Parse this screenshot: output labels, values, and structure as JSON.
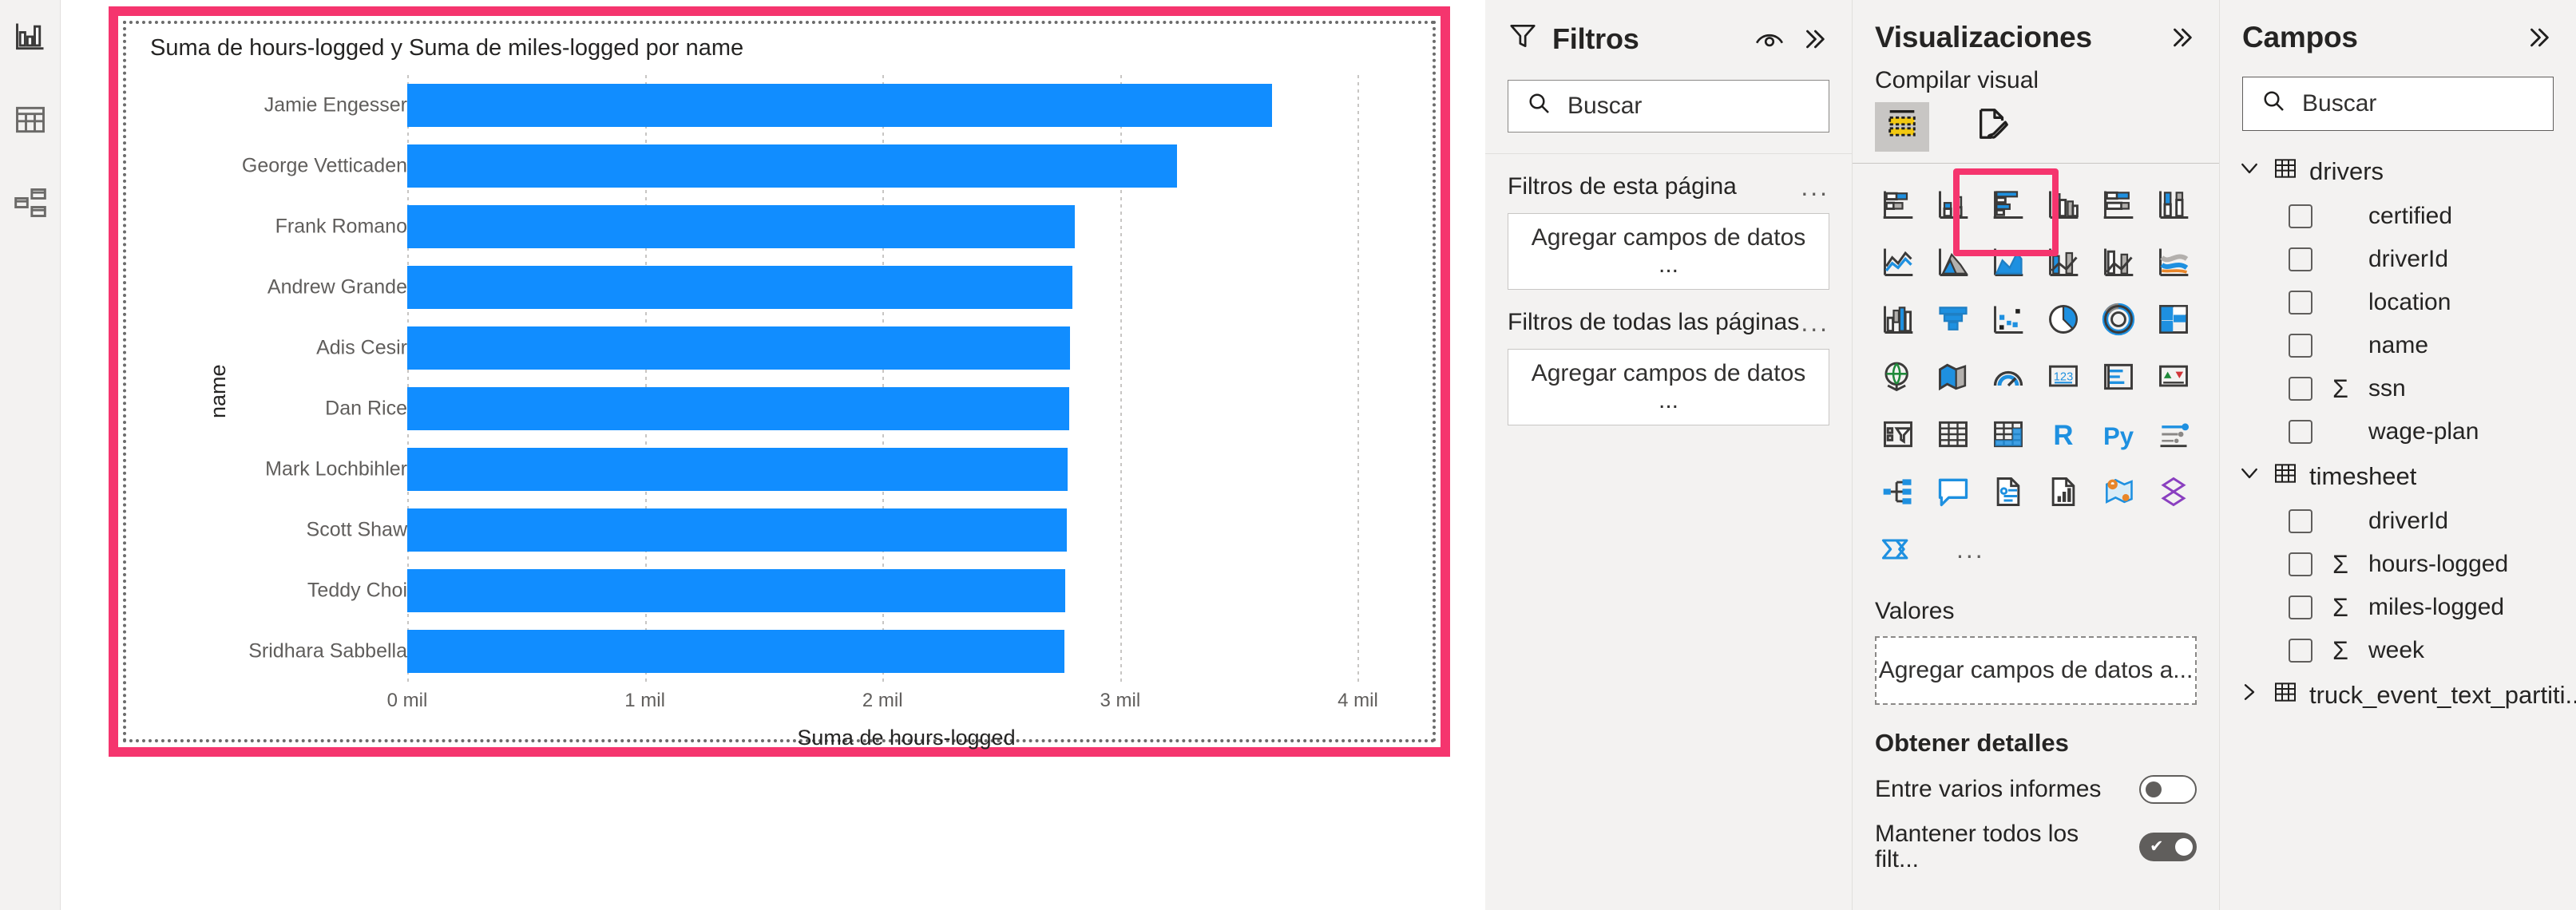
{
  "colors": {
    "bar": "#118dff",
    "selection_outline": "#f5356e",
    "panel_bg": "#f3f2f1"
  },
  "left_rail": {
    "items": [
      {
        "name": "report-view",
        "icon": "bar-chart-icon"
      },
      {
        "name": "data-view",
        "icon": "table-icon"
      },
      {
        "name": "model-view",
        "icon": "relationships-icon"
      }
    ]
  },
  "chart_data": {
    "type": "bar",
    "orientation": "horizontal",
    "title": "Suma de hours-logged y Suma de miles-logged por name",
    "xlabel": "Suma de hours-logged",
    "ylabel": "name",
    "categories": [
      "Jamie Engesser",
      "George Vetticaden",
      "Frank Romano",
      "Andrew Grande",
      "Adis Cesir",
      "Dan Rice",
      "Mark Lochbihler",
      "Scott Shaw",
      "Teddy Choi",
      "Sridhara Sabbella"
    ],
    "series": [
      {
        "name": "Suma de hours-logged",
        "values": [
          3640,
          3240,
          2810,
          2800,
          2790,
          2785,
          2780,
          2775,
          2770,
          2765
        ]
      }
    ],
    "xticks": [
      "0 mil",
      "1 mil",
      "2 mil",
      "3 mil",
      "4 mil"
    ],
    "xtick_values": [
      0,
      1000,
      2000,
      3000,
      4000
    ],
    "xlim": [
      0,
      4200
    ],
    "grid": true,
    "legend": false
  },
  "filters": {
    "title": "Filtros",
    "icons": {
      "funnel": "funnel-icon",
      "eye": "eye-icon",
      "expand": "chevron-double-right-icon"
    },
    "search": {
      "placeholder": "Buscar",
      "icon": "search-icon"
    },
    "groups": [
      {
        "label": "Filtros de esta página",
        "dropzone": "Agregar campos de datos ...",
        "menu": "..."
      },
      {
        "label": "Filtros de todas las páginas",
        "dropzone": "Agregar campos de datos ...",
        "menu": "..."
      }
    ]
  },
  "visualizations": {
    "title": "Visualizaciones",
    "expand_icon": "chevron-double-right-icon",
    "build_label": "Compilar visual",
    "build_tabs": [
      {
        "name": "build-visual-tab",
        "icon": "fields-build-icon",
        "active": true
      },
      {
        "name": "format-visual-tab",
        "icon": "paintbrush-icon",
        "active": false
      }
    ],
    "gallery": [
      "stacked-bar-chart-icon",
      "stacked-column-chart-icon",
      "clustered-bar-chart-icon",
      "clustered-column-chart-icon",
      "hundred-percent-stacked-bar-chart-icon",
      "hundred-percent-stacked-column-chart-icon",
      "line-chart-icon",
      "area-chart-icon",
      "stacked-area-chart-icon",
      "line-and-stacked-column-chart-icon",
      "line-and-clustered-column-chart-icon",
      "ribbon-chart-icon",
      "waterfall-chart-icon",
      "funnel-chart-icon",
      "scatter-chart-icon",
      "pie-chart-icon",
      "donut-chart-icon",
      "treemap-icon",
      "map-icon",
      "filled-map-icon",
      "gauge-icon",
      "card-icon",
      "multi-row-card-icon",
      "kpi-icon",
      "slicer-icon",
      "table-icon",
      "matrix-icon",
      "r-script-visual-icon",
      "python-visual-icon",
      "key-influencers-icon",
      "decomposition-tree-icon",
      "qna-icon",
      "smart-narrative-icon",
      "paginated-report-icon",
      "arcgis-maps-icon",
      "power-apps-icon",
      "power-automate-icon"
    ],
    "selected_gallery_item": "stacked-column-chart-icon",
    "more_icon": "...",
    "values_label": "Valores",
    "values_dropzone": "Agregar campos de datos a...",
    "drill_label": "Obtener detalles",
    "toggles": [
      {
        "label": "Entre varios informes",
        "state": "off"
      },
      {
        "label": "Mantener todos los filt...",
        "state": "on"
      }
    ]
  },
  "fields": {
    "title": "Campos",
    "expand_icon": "chevron-double-right-icon",
    "search": {
      "placeholder": "Buscar",
      "icon": "search-icon"
    },
    "tables": [
      {
        "name": "drivers",
        "expanded": true,
        "fields": [
          {
            "label": "certified",
            "checked": false,
            "measure": false
          },
          {
            "label": "driverId",
            "checked": false,
            "measure": false
          },
          {
            "label": "location",
            "checked": false,
            "measure": false
          },
          {
            "label": "name",
            "checked": false,
            "measure": false
          },
          {
            "label": "ssn",
            "checked": false,
            "measure": true
          },
          {
            "label": "wage-plan",
            "checked": false,
            "measure": false
          }
        ]
      },
      {
        "name": "timesheet",
        "expanded": true,
        "fields": [
          {
            "label": "driverId",
            "checked": false,
            "measure": false
          },
          {
            "label": "hours-logged",
            "checked": false,
            "measure": true
          },
          {
            "label": "miles-logged",
            "checked": false,
            "measure": true
          },
          {
            "label": "week",
            "checked": false,
            "measure": true
          }
        ]
      },
      {
        "name": "truck_event_text_partiti...",
        "expanded": false,
        "fields": []
      }
    ]
  }
}
